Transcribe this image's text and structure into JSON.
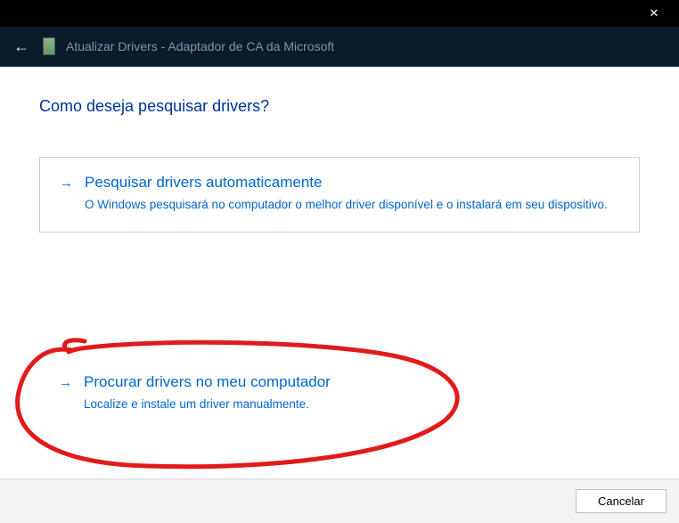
{
  "titlebar": {
    "close_symbol": "✕"
  },
  "header": {
    "back_symbol": "←",
    "title": "Atualizar Drivers - Adaptador de CA da Microsoft"
  },
  "main": {
    "question": "Como deseja pesquisar drivers?",
    "option1": {
      "arrow": "→",
      "title": "Pesquisar drivers automaticamente",
      "description": "O Windows pesquisará no computador o melhor driver disponível e o instalará em seu dispositivo."
    },
    "option2": {
      "arrow": "→",
      "title": "Procurar drivers no meu computador",
      "description": "Localize e instale um driver manualmente."
    }
  },
  "footer": {
    "cancel_label": "Cancelar"
  },
  "annotation": {
    "stroke_color": "#e11b1b"
  }
}
